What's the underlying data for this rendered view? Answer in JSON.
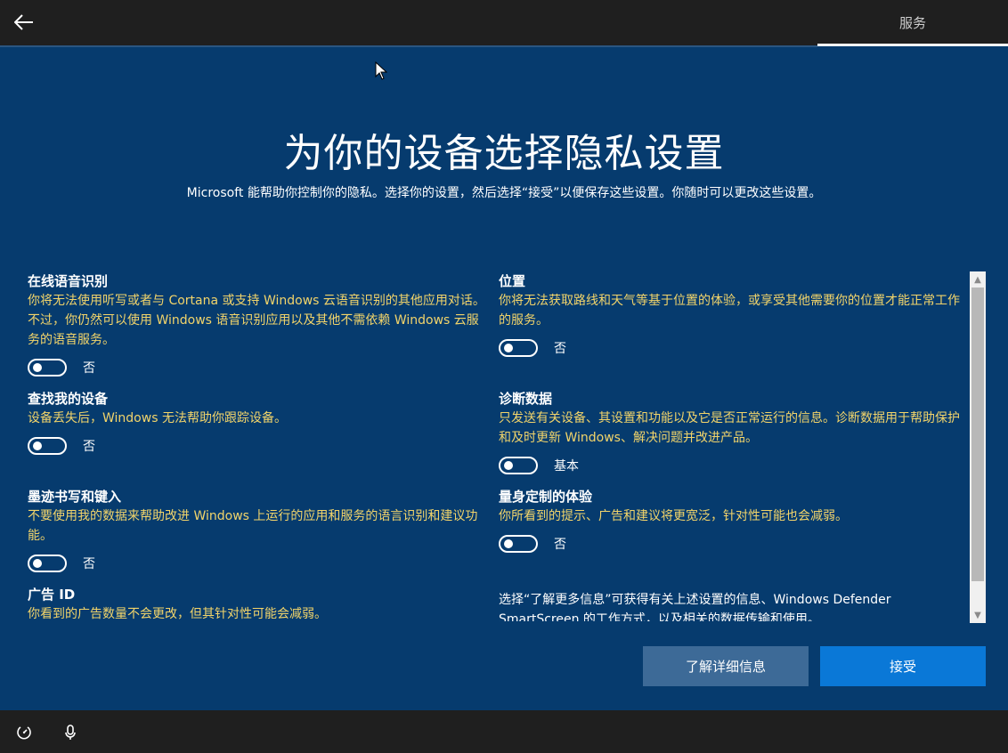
{
  "header": {
    "tab_label": "服务"
  },
  "main": {
    "title": "为你的设备选择隐私设置",
    "subtitle": "Microsoft 能帮助你控制你的隐私。选择你的设置，然后选择“接受”以便保存这些设置。你随时可以更改这些设置。"
  },
  "settings_left": [
    {
      "name": "在线语音识别",
      "desc": "你将无法使用听写或者与 Cortana 或支持 Windows 云语音识别的其他应用对话。不过，你仍然可以使用 Windows 语音识别应用以及其他不需依赖 Windows 云服务的语音服务。",
      "state": "否"
    },
    {
      "name": "查找我的设备",
      "desc": "设备丢失后，Windows 无法帮助你跟踪设备。",
      "state": "否"
    },
    {
      "name": "墨迹书写和键入",
      "desc": "不要使用我的数据来帮助改进 Windows 上运行的应用和服务的语言识别和建议功能。",
      "state": "否"
    },
    {
      "name": "广告 ID",
      "desc": "你看到的广告数量不会更改，但其针对性可能会减弱。"
    }
  ],
  "settings_right": [
    {
      "name": "位置",
      "desc": "你将无法获取路线和天气等基于位置的体验，或享受其他需要你的位置才能正常工作的服务。",
      "state": "否"
    },
    {
      "name": "诊断数据",
      "desc": "只发送有关设备、其设置和功能以及它是否正常运行的信息。诊断数据用于帮助保护和及时更新 Windows、解决问题并改进产品。",
      "state": "基本"
    },
    {
      "name": "量身定制的体验",
      "desc": "你所看到的提示、广告和建议将更宽泛，针对性可能也会减弱。",
      "state": "否"
    }
  ],
  "footnote": "选择“了解更多信息”可获得有关上述设置的信息、Windows Defender SmartScreen 的工作方式，以及相关的数据传输和使用。",
  "buttons": {
    "learn_more": "了解详细信息",
    "accept": "接受"
  },
  "icons": {
    "back": "back-arrow-icon",
    "ease_of_access": "ease-of-access-icon",
    "microphone": "microphone-icon"
  }
}
